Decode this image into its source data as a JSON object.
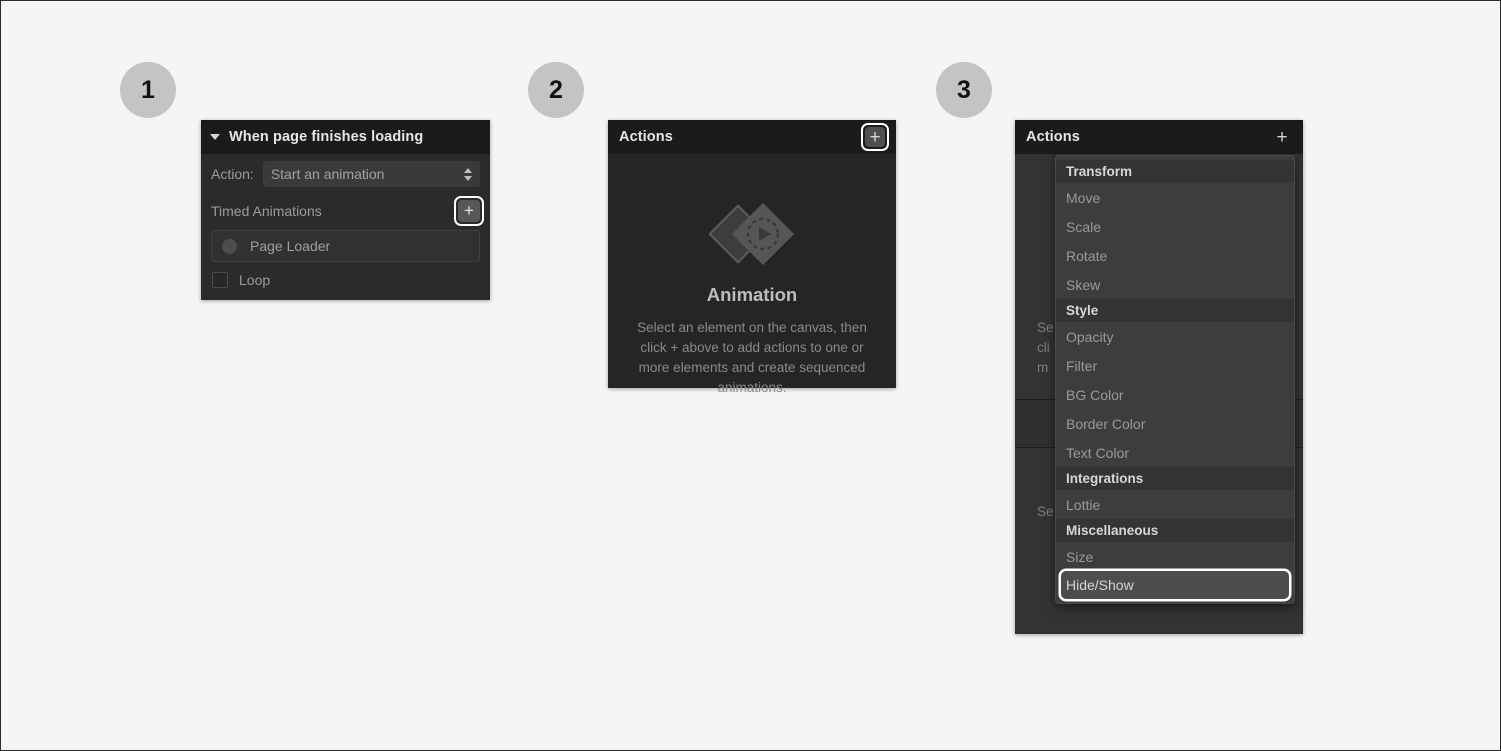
{
  "steps": [
    {
      "number": "1"
    },
    {
      "number": "2"
    },
    {
      "number": "3"
    }
  ],
  "colors": {
    "page_bg": "#f4f5f7",
    "badge_bg": "#c4c4c4",
    "panel_bg": "#2b2b2b",
    "panel_header_bg": "#1b1b1b",
    "menu_bg": "#3d3d3d",
    "focus_ring": "#ffffff"
  },
  "panel_trigger": {
    "title": "When page finishes loading",
    "caret_icon": "chevron-down-icon",
    "action_label": "Action:",
    "action_value": "Start an animation",
    "action_stepper_icon": "stepper-updown-icon",
    "timed_animations_label": "Timed Animations",
    "add_icon": "plus-icon",
    "animations": [
      {
        "icon": "circle-icon",
        "label": "Page Loader"
      }
    ],
    "loop_label": "Loop",
    "loop_checked": false
  },
  "panel_actions_empty": {
    "title": "Actions",
    "add_icon": "plus-icon",
    "art_icon": "animation-diamonds-play-icon",
    "empty_title": "Animation",
    "empty_description": "Select an element on the canvas, then click + above to add actions to one or more elements and create sequenced animations."
  },
  "panel_actions_menu": {
    "title": "Actions",
    "add_icon": "plus-icon",
    "background_text_lines": [
      "Se",
      "cli",
      "m",
      "Se"
    ],
    "dropdown": {
      "groups": [
        {
          "header": "Transform",
          "items": [
            "Move",
            "Scale",
            "Rotate",
            "Skew"
          ]
        },
        {
          "header": "Style",
          "items": [
            "Opacity",
            "Filter",
            "BG Color",
            "Border Color",
            "Text Color"
          ]
        },
        {
          "header": "Integrations",
          "items": [
            "Lottie"
          ]
        },
        {
          "header": "Miscellaneous",
          "items": [
            "Size",
            "Hide/Show"
          ]
        }
      ],
      "selected_item": "Hide/Show"
    }
  }
}
